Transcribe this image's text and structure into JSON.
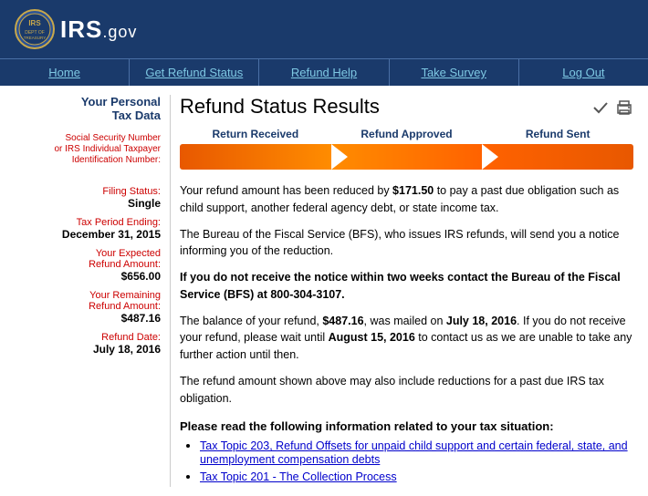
{
  "header": {
    "logo_text": "IRS",
    "logo_suffix": ".gov"
  },
  "nav": {
    "items": [
      {
        "label": "Home",
        "id": "home"
      },
      {
        "label": "Get Refund Status",
        "id": "get-refund-status"
      },
      {
        "label": "Refund Help",
        "id": "refund-help"
      },
      {
        "label": "Take Survey",
        "id": "take-survey"
      },
      {
        "label": "Log Out",
        "id": "log-out"
      }
    ]
  },
  "sidebar": {
    "title_line1": "Your Personal",
    "title_line2": "Tax Data",
    "fields": [
      {
        "label": "Social Security Number",
        "label_sub": "or IRS Individual Taxpayer Identification Number:",
        "value": ""
      },
      {
        "label": "Filing Status:",
        "value": "Single"
      },
      {
        "label": "Tax Period Ending:",
        "value": "December 31, 2015"
      },
      {
        "label": "Your Expected Refund Amount:",
        "value": "$656.00"
      },
      {
        "label": "Your Remaining Refund Amount:",
        "value": "$487.16"
      },
      {
        "label": "Refund Date:",
        "value": "July 18, 2016"
      }
    ]
  },
  "content": {
    "page_title": "Refund Status Results",
    "progress": {
      "steps": [
        "Return Received",
        "Refund Approved",
        "Refund Sent"
      ]
    },
    "messages": [
      {
        "id": "msg1",
        "text_parts": [
          {
            "type": "normal",
            "text": "Your refund amount has been reduced by "
          },
          {
            "type": "bold",
            "text": "$171.50"
          },
          {
            "type": "normal",
            "text": " to pay a past due obligation such as child support, another federal agency debt, or state income tax."
          }
        ]
      },
      {
        "id": "msg2",
        "text": "The Bureau of the Fiscal Service (BFS), who issues IRS refunds, will send you a notice informing you of the reduction."
      },
      {
        "id": "msg3",
        "bold": true,
        "text_parts": [
          {
            "type": "bold",
            "text": "If you do not receive the notice within two weeks contact the Bureau of the Fiscal Service (BFS) at 800-304-3107."
          }
        ]
      },
      {
        "id": "msg4",
        "text_parts": [
          {
            "type": "normal",
            "text": "The balance of your refund, "
          },
          {
            "type": "bold",
            "text": "$487.16"
          },
          {
            "type": "normal",
            "text": ", was mailed on "
          },
          {
            "type": "bold",
            "text": "July 18, 2016"
          },
          {
            "type": "normal",
            "text": ". If you do not receive your refund, please wait until "
          },
          {
            "type": "bold",
            "text": "August 15, 2016"
          },
          {
            "type": "normal",
            "text": " to contact us as we are unable to take any further action until then."
          }
        ]
      },
      {
        "id": "msg5",
        "text": "The refund amount shown above may also include reductions for a past due IRS tax obligation."
      }
    ],
    "please_read_label": "Please read the following information related to your tax situation:",
    "links": [
      {
        "label": "Tax Topic 203, Refund Offsets for unpaid child support and certain federal, state, and unemployment compensation debts",
        "href": "#"
      },
      {
        "label": "Tax Topic 201 - The Collection Process",
        "href": "#"
      }
    ]
  }
}
